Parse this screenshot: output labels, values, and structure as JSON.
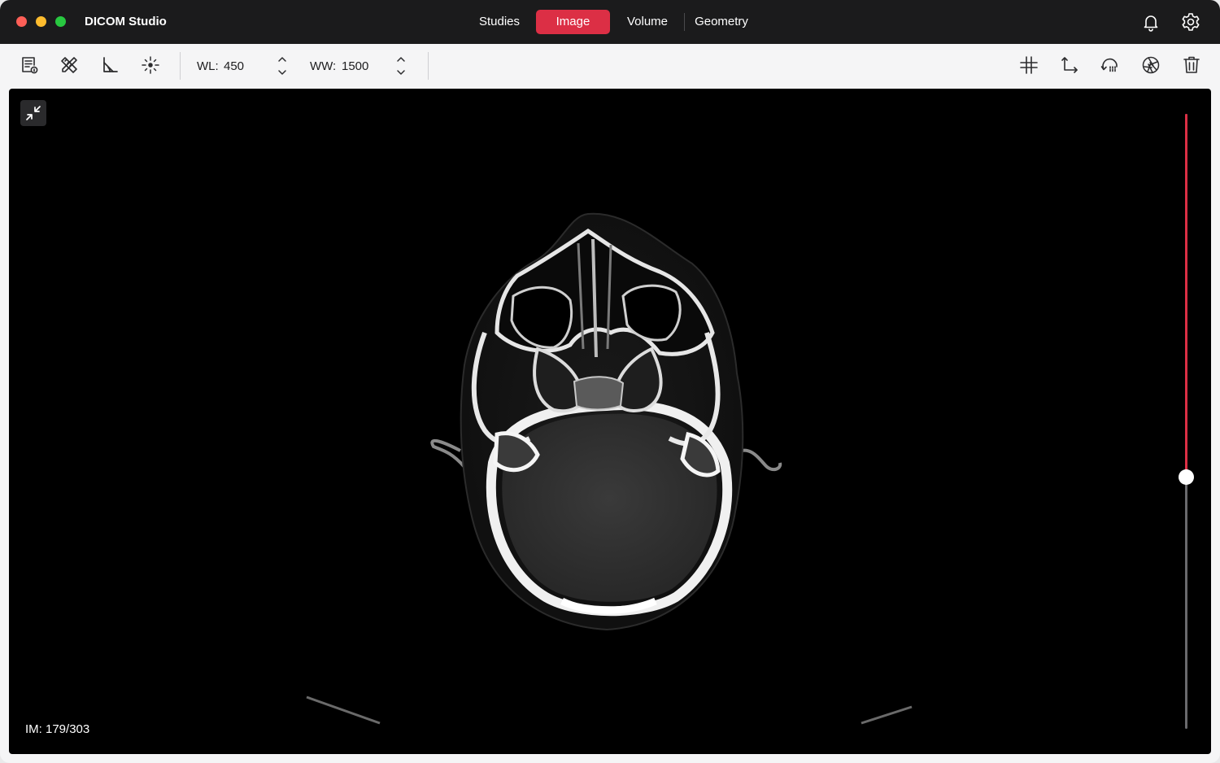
{
  "app": {
    "title": "DICOM Studio"
  },
  "tabs": [
    {
      "label": "Studies",
      "active": false
    },
    {
      "label": "Image",
      "active": true
    },
    {
      "label": "Volume",
      "active": false
    },
    {
      "label": "Geometry",
      "active": false
    }
  ],
  "titlebar_icons": [
    "bell-icon",
    "gear-icon"
  ],
  "toolbar": {
    "left_tools": [
      "document-info-icon",
      "pencil-ruler-icon",
      "angle-icon",
      "crosshair-icon"
    ],
    "wl": {
      "label": "WL:",
      "value": "450"
    },
    "ww": {
      "label": "WW:",
      "value": "1500"
    },
    "right_tools": [
      "grid-icon",
      "axis-icon",
      "rotate-icon",
      "aperture-icon",
      "trash-icon"
    ]
  },
  "viewer": {
    "image_index": "IM: 179/303",
    "slice_current": 179,
    "slice_total": 303
  },
  "colors": {
    "accent": "#dc2f45",
    "titlebar": "#1b1b1c",
    "toolbar": "#f5f5f6",
    "viewport": "#000000"
  }
}
